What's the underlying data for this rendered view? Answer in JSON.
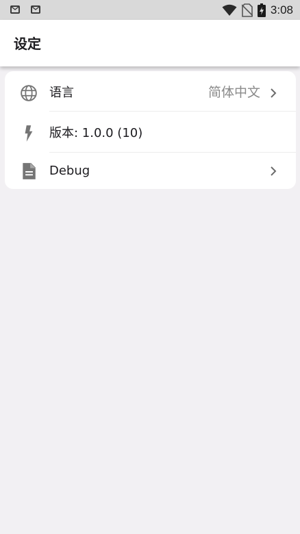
{
  "status_bar": {
    "time": "3:08",
    "notification_icons": [
      "mail-icon",
      "mail-icon"
    ],
    "system_icons": [
      "wifi-icon",
      "no-sim-icon",
      "battery-charging-icon"
    ]
  },
  "app_bar": {
    "title": "设定"
  },
  "settings": {
    "items": [
      {
        "icon": "globe-icon",
        "label": "语言",
        "value": "简体中文",
        "has_chevron": true
      },
      {
        "icon": "bolt-icon",
        "label": "版本: 1.0.0 (10)",
        "value": "",
        "has_chevron": false
      },
      {
        "icon": "document-icon",
        "label": "Debug",
        "value": "",
        "has_chevron": true
      }
    ]
  },
  "colors": {
    "background": "#f2f0f3",
    "surface": "#ffffff",
    "status_bar": "#d9d9d9",
    "icon": "#757575",
    "text_primary": "#1c1b1f",
    "text_secondary": "#8a8a8a"
  }
}
